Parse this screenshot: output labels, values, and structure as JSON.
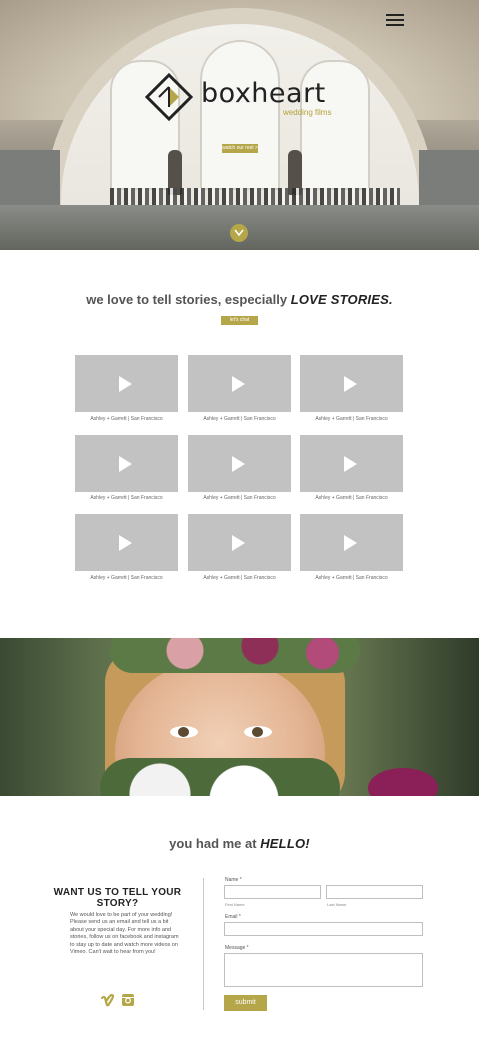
{
  "hero": {
    "brand_name": "boxheart",
    "brand_tagline": "wedding films",
    "cta_label": "watch our reel  >",
    "icons": [
      "menu-icon",
      "logo-diamond-icon",
      "chevron-down-icon"
    ],
    "accent_color": "#b5a64a"
  },
  "stories": {
    "headline_prefix": "we love to tell stories, especially",
    "headline_emphasis": "LOVE STORIES.",
    "cta_label": "let's chat",
    "videos": [
      {
        "caption": "Ashley + Garrett  |  San Francisco"
      },
      {
        "caption": "Ashley + Garrett  |  San Francisco"
      },
      {
        "caption": "Ashley + Garrett  |  San Francisco"
      },
      {
        "caption": "Ashley + Garrett  |  San Francisco"
      },
      {
        "caption": "Ashley + Garrett  |  San Francisco"
      },
      {
        "caption": "Ashley + Garrett  |  San Francisco"
      },
      {
        "caption": "Ashley + Garrett  |  San Francisco"
      },
      {
        "caption": "Ashley + Garrett  |  San Francisco"
      },
      {
        "caption": "Ashley + Garrett  |  San Francisco"
      }
    ]
  },
  "hello": {
    "prefix": "you had me at",
    "emphasis": "HELLO!"
  },
  "contact": {
    "title": "WANT US TO TELL YOUR STORY?",
    "body": "We would love to be part of your wedding! Please send us an email and tell us a bit about your special day. For more info and stories, follow us on facebook and instagram to stay up to date and watch more videos on Vimeo. Can't wait to hear from you!",
    "social_icons": [
      "vimeo-icon",
      "instagram-icon"
    ],
    "form": {
      "name_label": "Name *",
      "first_name_sublabel": "First Name",
      "last_name_sublabel": "Last Name",
      "email_label": "Email *",
      "message_label": "Message *",
      "submit_label": "submit"
    }
  }
}
